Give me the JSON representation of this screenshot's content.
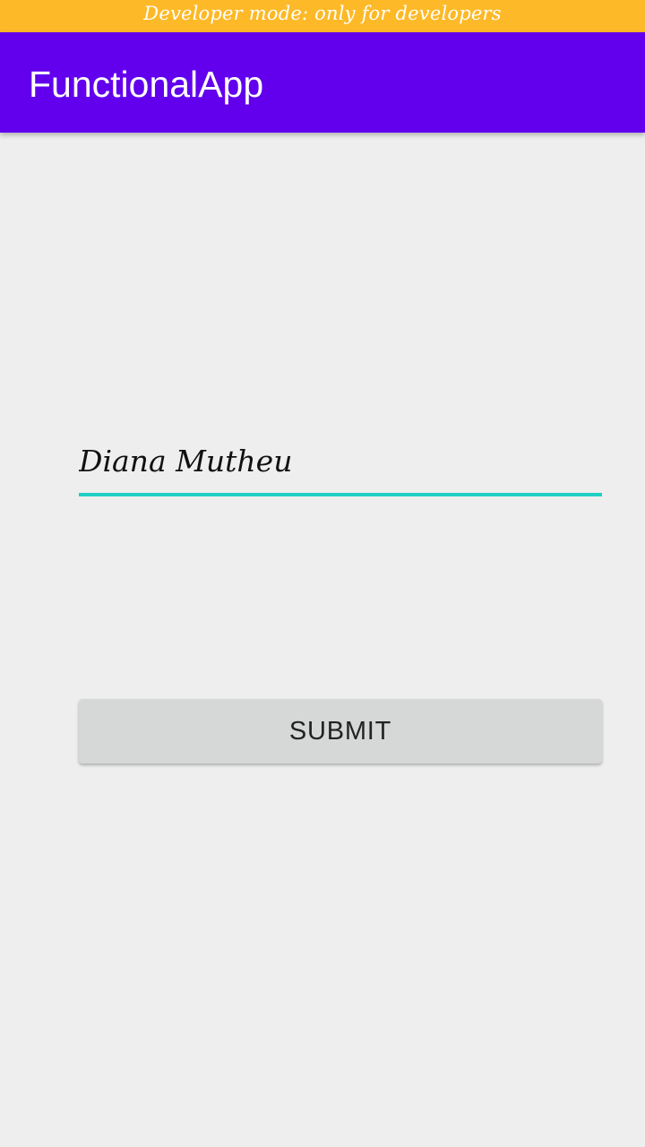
{
  "banner": {
    "text": "Developer mode: only for developers"
  },
  "app_bar": {
    "title": "FunctionalApp"
  },
  "form": {
    "name_value": "Diana Mutheu",
    "submit_label": "SUBMIT"
  },
  "colors": {
    "banner": "#fdb927",
    "app_bar": "#6200ee",
    "input_underline": "#1fcfc4",
    "button_bg": "#d6d7d7",
    "background": "#eeeeee"
  }
}
